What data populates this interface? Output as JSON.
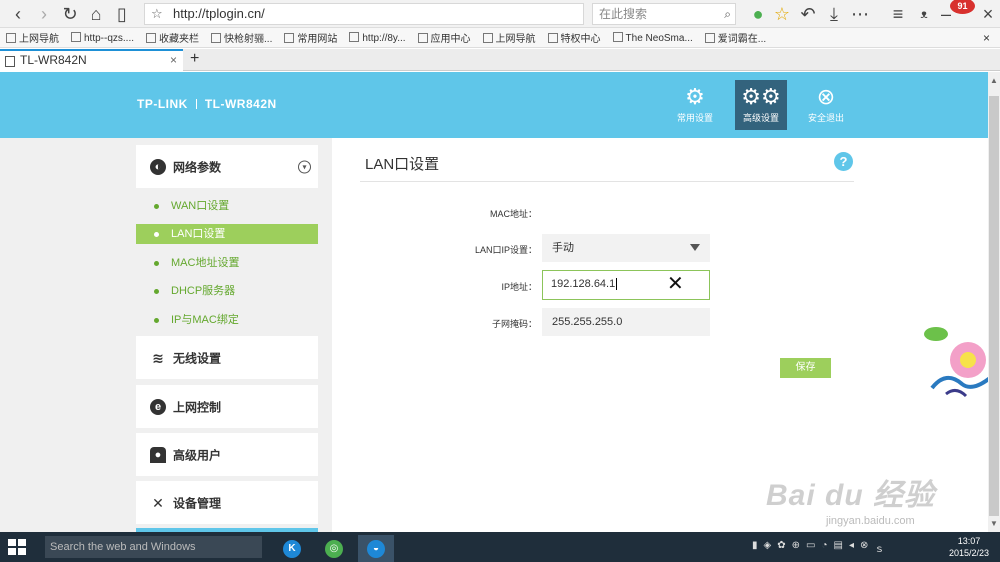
{
  "browser": {
    "url": "http://tplogin.cn/",
    "search_placeholder": "在此搜索",
    "badge_count": "91",
    "bookmarks": [
      "上网导航",
      "http--qzs....",
      "收藏夹栏",
      "快枪射骊...",
      "常用网站",
      "http://8y...",
      "应用中心",
      "上网导航",
      "特权中心",
      "The NeoSma...",
      "爱词霸在..."
    ],
    "tab_title": "TL-WR842N",
    "new_tab": "+"
  },
  "header": {
    "brand": "TP-LINK",
    "model": "TL-WR842N",
    "buttons": [
      {
        "label": "常用设置",
        "icon": "gear-icon"
      },
      {
        "label": "高级设置",
        "icon": "gears-icon"
      },
      {
        "label": "安全退出",
        "icon": "exit-icon"
      }
    ]
  },
  "sidebar": {
    "network": "网络参数",
    "subitems": [
      "WAN口设置",
      "LAN口设置",
      "MAC地址设置",
      "DHCP服务器",
      "IP与MAC绑定"
    ],
    "wireless": "无线设置",
    "internet_control": "上网控制",
    "advanced_users": "高级用户",
    "device_mgmt": "设备管理"
  },
  "main": {
    "title": "LAN口设置",
    "help": "?",
    "mac_label": "MAC地址：",
    "ipmode_label": "LAN口IP设置：",
    "ipmode_value": "手动",
    "ip_label": "IP地址：",
    "ip_value": "192.128.64.1",
    "ip_clear": "✕",
    "mask_label": "子网掩码：",
    "mask_value": "255.255.255.0",
    "save": "保存"
  },
  "taskbar": {
    "search_placeholder": "Search the web and Windows",
    "time": "13:07",
    "date": "2015/2/23"
  },
  "watermark": {
    "main": "Bai du 经验",
    "sub": "jingyan.baidu.com"
  },
  "colors": {
    "header": "#5fc6e9",
    "active": "#9dcf5c",
    "accent_dark": "#33637d"
  }
}
